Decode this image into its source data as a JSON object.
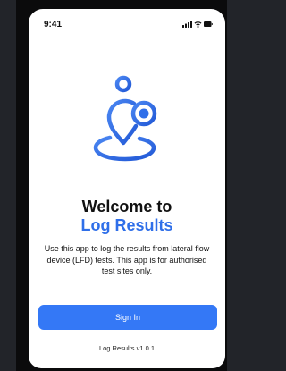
{
  "status_bar": {
    "time": "9:41",
    "icons": [
      "signal-icon",
      "wifi-icon",
      "battery-icon"
    ]
  },
  "logo": {
    "icon": "location-pin-person-icon",
    "color": "#2f6fe9"
  },
  "welcome": {
    "line1": "Welcome to",
    "line2": "Log Results"
  },
  "description": "Use this app to log the results from lateral flow device (LFD) tests. This app is for authorised test sites only.",
  "sign_in_label": "Sign In",
  "version": "Log Results v1.0.1",
  "colors": {
    "accent": "#3478f6",
    "title_blue": "#2f6fe9"
  }
}
